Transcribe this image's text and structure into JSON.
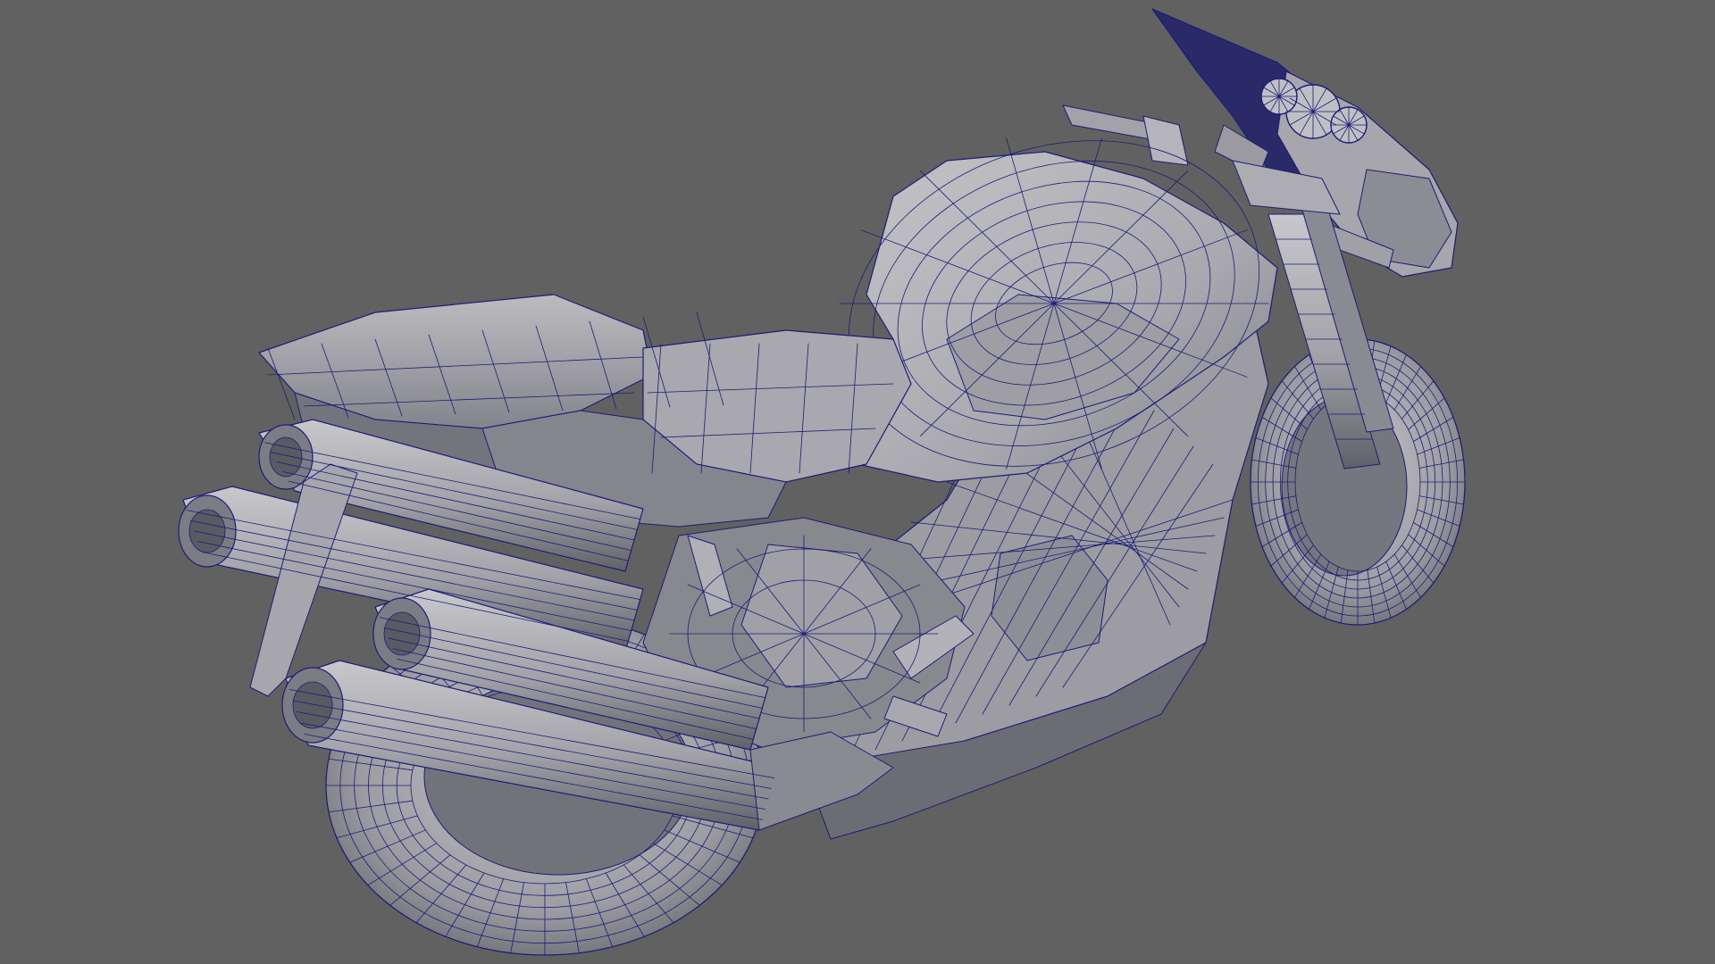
{
  "viewport": {
    "background_color": "#616161",
    "model": "motorcycle",
    "display_mode": "smooth-shade-wireframe-on-shaded"
  },
  "colors": {
    "mesh_light": "#b8b8bc",
    "mesh_mid": "#9a9aa0",
    "mesh_dark": "#6e6e76",
    "mesh_shadow": "#505058",
    "wireframe": "#1c1c78"
  }
}
